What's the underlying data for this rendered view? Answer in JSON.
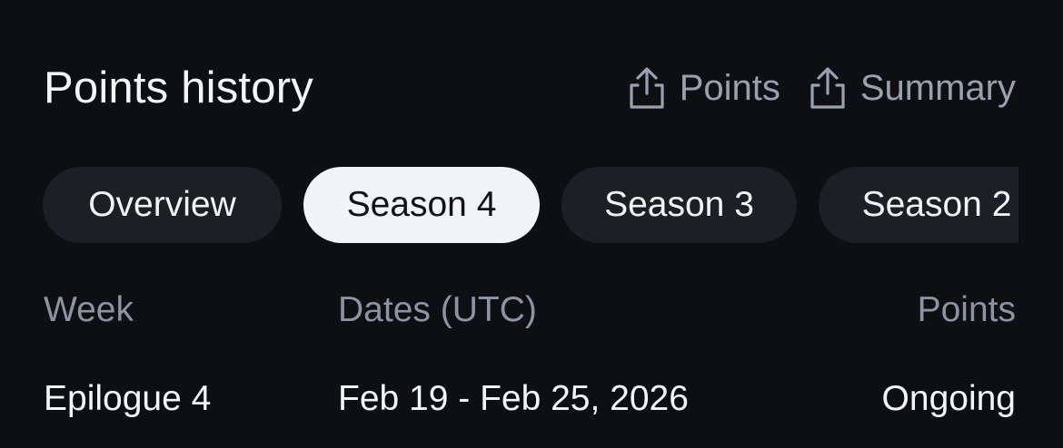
{
  "header": {
    "title": "Points history",
    "export_points_label": "Points",
    "export_summary_label": "Summary",
    "export_icon": "share-upload-icon"
  },
  "tabs": [
    {
      "label": "Overview",
      "active": false
    },
    {
      "label": "Season 4",
      "active": true
    },
    {
      "label": "Season 3",
      "active": false
    },
    {
      "label": "Season 2",
      "active": false
    }
  ],
  "table": {
    "columns": [
      "Week",
      "Dates (UTC)",
      "Points"
    ],
    "rows": [
      {
        "week": "Epilogue 4",
        "dates": "Feb 19 - Feb 25, 2026",
        "points": "Ongoing"
      }
    ]
  },
  "colors": {
    "background": "#0e0f13",
    "pill": "#1d1f24",
    "pill_active": "#f3f4f6",
    "muted_text": "#8d94a1"
  }
}
